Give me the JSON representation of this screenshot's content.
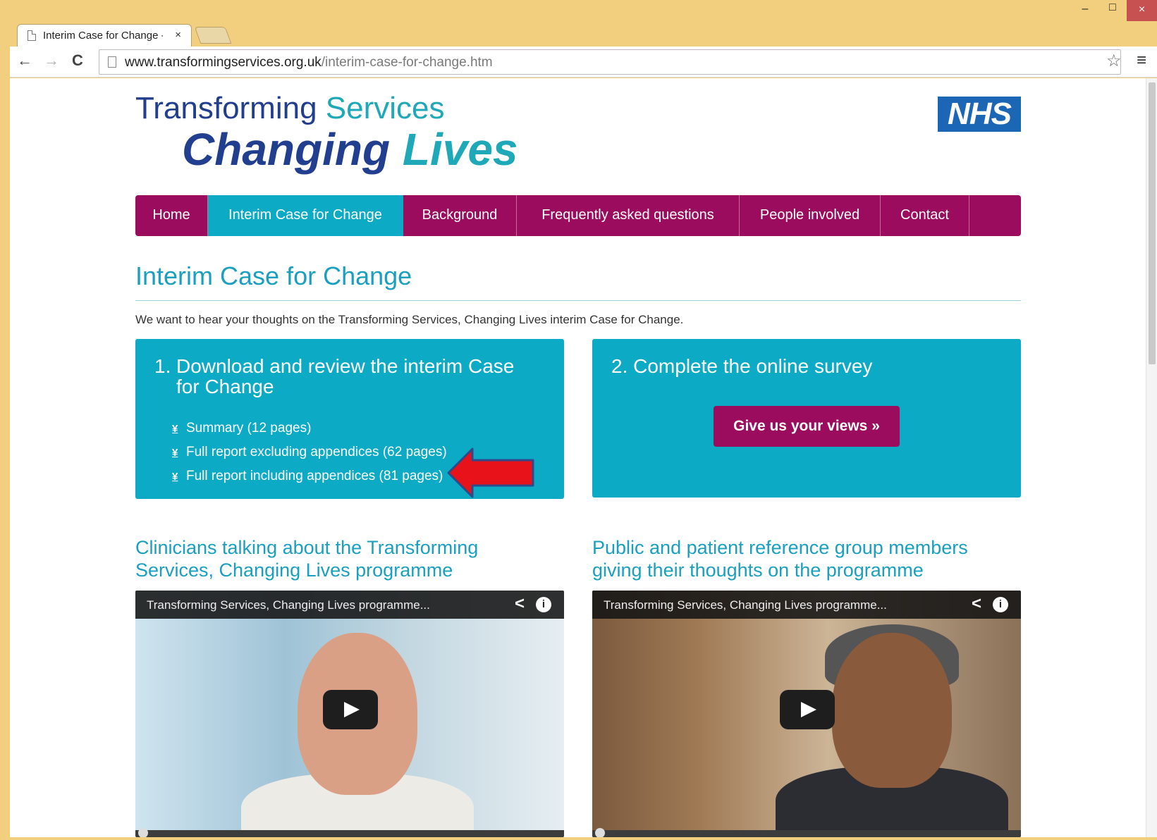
{
  "browser": {
    "tab_title": "Interim Case for Change - ",
    "tab_close": "×",
    "url_host": "www.transformingservices.org.uk",
    "url_path": "/interim-case-for-change.htm",
    "window_min": "–",
    "window_max": "□",
    "window_close": "×",
    "back": "←",
    "forward": "→",
    "reload": "C",
    "star": "☆",
    "menu": "≡"
  },
  "logo": {
    "line1_a": "Transforming ",
    "line1_b": "Services",
    "line2_a": "Changing ",
    "line2_b": "Lives",
    "nhs": "NHS"
  },
  "nav": {
    "items": [
      {
        "label": "Home"
      },
      {
        "label": "Interim Case for Change"
      },
      {
        "label": "Background"
      },
      {
        "label": "Frequently asked questions"
      },
      {
        "label": "People involved"
      },
      {
        "label": "Contact"
      }
    ],
    "active_index": 1
  },
  "page": {
    "title": "Interim Case for Change",
    "intro": "We want to hear your thoughts on the Transforming Services, Changing Lives interim Case for Change."
  },
  "download_box": {
    "number": "1.",
    "heading": "Download and review the interim Case for Change",
    "download_icon": "¥",
    "links": [
      {
        "label": "Summary (12 pages)"
      },
      {
        "label": "Full report excluding appendices (62 pages)"
      },
      {
        "label": "Full report including appendices (81 pages)"
      }
    ]
  },
  "survey_box": {
    "heading": "2. Complete the online survey",
    "button": "Give us your views »"
  },
  "videos": [
    {
      "section_heading": "Clinicians talking about the Transforming Services, Changing Lives programme",
      "title": "Transforming Services, Changing Lives programme...",
      "share_icon": "<",
      "info_icon": "i"
    },
    {
      "section_heading": "Public and patient reference group members giving their thoughts on the programme",
      "title": "Transforming Services, Changing Lives programme...",
      "share_icon": "<",
      "info_icon": "i"
    }
  ],
  "colors": {
    "brand_magenta": "#9b0b5e",
    "brand_teal": "#0daac6",
    "heading_teal": "#1aa0be",
    "logo_navy": "#213f8e",
    "nhs_blue": "#1b66b5",
    "annotation_arrow": "#e8131a"
  }
}
